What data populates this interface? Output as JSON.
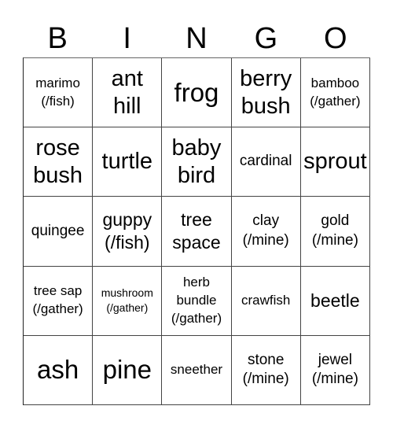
{
  "header": [
    "B",
    "I",
    "N",
    "G",
    "O"
  ],
  "cells": [
    [
      "marimo\n(/fish)",
      "ant\nhill",
      "frog",
      "berry\nbush",
      "bamboo\n(/gather)"
    ],
    [
      "rose\nbush",
      "turtle",
      "baby\nbird",
      "cardinal",
      "sprout"
    ],
    [
      "quingee",
      "guppy\n(/fish)",
      "tree\nspace",
      "clay\n(/mine)",
      "gold\n(/mine)"
    ],
    [
      "tree sap\n(/gather)",
      "mushroom\n(/gather)",
      "herb\nbundle\n(/gather)",
      "crawfish",
      "beetle"
    ],
    [
      "ash",
      "pine",
      "sneether",
      "stone\n(/mine)",
      "jewel\n(/mine)"
    ]
  ]
}
